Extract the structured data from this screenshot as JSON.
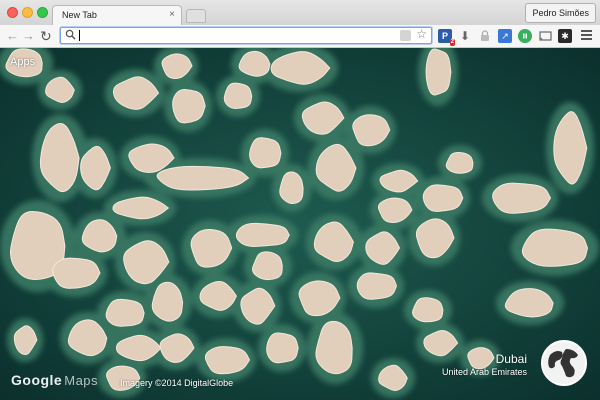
{
  "window": {
    "tab_title": "New Tab",
    "tab_close": "×",
    "profile_name": "Pedro Simões"
  },
  "toolbar": {
    "back": "←",
    "forward": "→",
    "reload": "↻",
    "address_value": "",
    "bookmark_star": "☆",
    "extensions": [
      {
        "name": "p-extension-icon",
        "glyph": "P",
        "badge": "2"
      },
      {
        "name": "download-icon",
        "glyph": "⬇"
      },
      {
        "name": "lock-icon",
        "glyph": "🔒"
      },
      {
        "name": "blue-extension-icon",
        "glyph": "↗"
      },
      {
        "name": "green-extension-icon",
        "glyph": "●"
      },
      {
        "name": "cast-icon",
        "glyph": "▭"
      },
      {
        "name": "dark-extension-icon",
        "glyph": "✱"
      }
    ],
    "menu_icon": "hamburger-menu-icon"
  },
  "newtab": {
    "apps_label": "Apps",
    "google_logo": "Google",
    "google_logo_suffix": "Maps",
    "imagery_credit": "Imagery ©2014 DigitalGlobe",
    "location_city": "Dubai",
    "location_country": "United Arab Emirates"
  },
  "colors": {
    "water": "#0f3a37",
    "sand": "#e4d2bf",
    "shallow": "#3a7a63"
  }
}
